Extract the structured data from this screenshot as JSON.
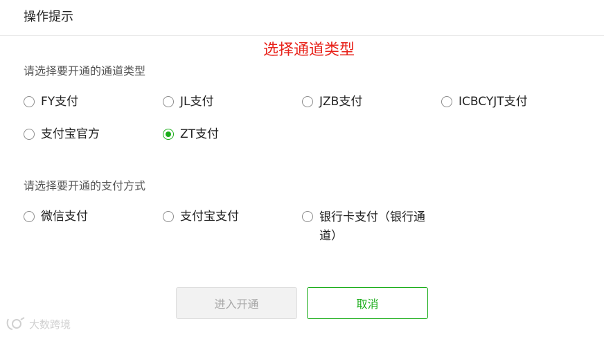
{
  "dialog": {
    "title": "操作提示",
    "annotation": "选择通道类型"
  },
  "channel_section": {
    "label": "请选择要开通的通道类型",
    "options": [
      {
        "label": "FY支付",
        "checked": false
      },
      {
        "label": "JL支付",
        "checked": false
      },
      {
        "label": "JZB支付",
        "checked": false
      },
      {
        "label": "ICBCYJT支付",
        "checked": false
      },
      {
        "label": "支付宝官方",
        "checked": false
      },
      {
        "label": "ZT支付",
        "checked": true
      }
    ]
  },
  "payment_section": {
    "label": "请选择要开通的支付方式",
    "options": [
      {
        "label": "微信支付",
        "checked": false
      },
      {
        "label": "支付宝支付",
        "checked": false
      },
      {
        "label": "银行卡支付（银行通道）",
        "checked": false
      }
    ]
  },
  "buttons": {
    "enter_label": "进入开通",
    "cancel_label": "取消"
  },
  "watermark": {
    "text": "大数跨境"
  },
  "colors": {
    "accent": "#1aad19",
    "annotation": "#e8231b",
    "disabled_bg": "#f2f2f2"
  }
}
